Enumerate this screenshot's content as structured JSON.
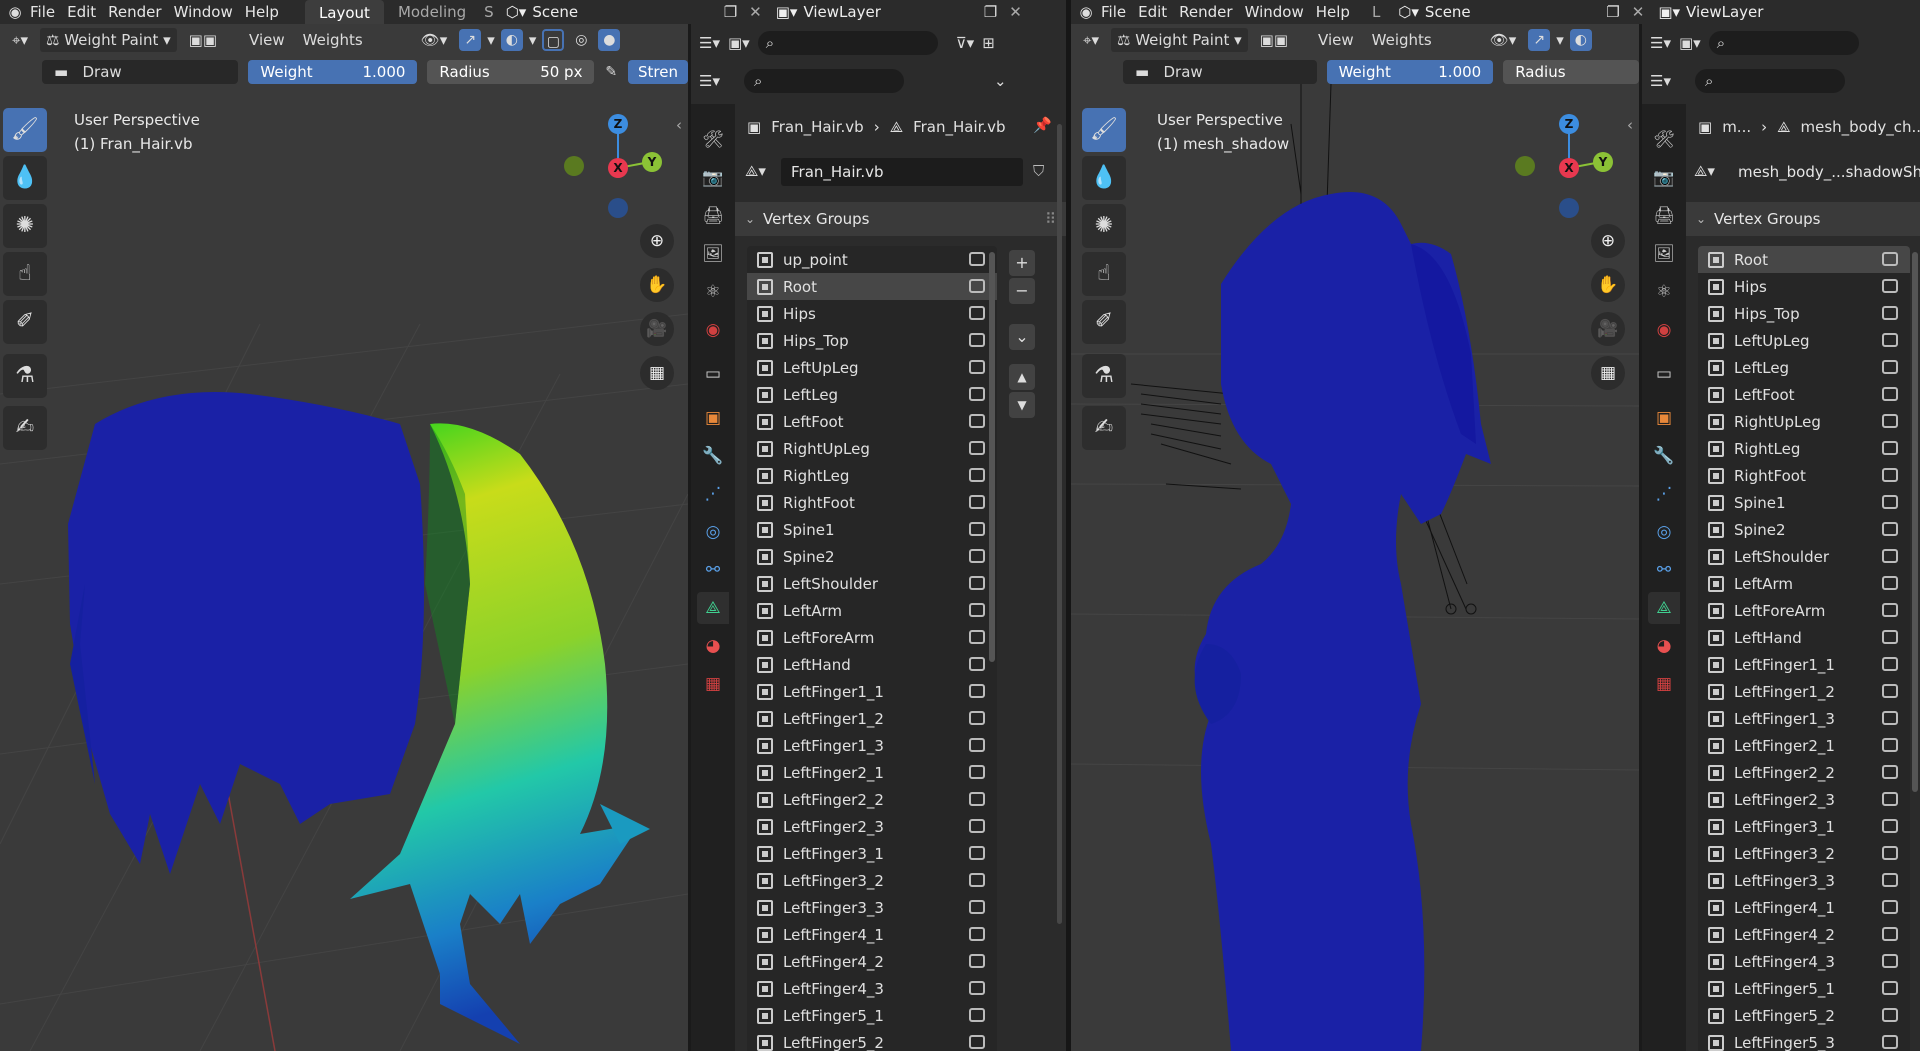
{
  "left": {
    "topbar": {
      "menus": [
        "File",
        "Edit",
        "Render",
        "Window",
        "Help"
      ],
      "workspace_tabs": [
        "Layout",
        "Modeling",
        "S"
      ],
      "active_tab": "Layout",
      "scene": "Scene",
      "viewlayer": "ViewLayer"
    },
    "viewport": {
      "mode": "Weight Paint",
      "view_menu": "View",
      "weights_menu": "Weights",
      "brush": "Draw",
      "weight_label": "Weight",
      "weight_value": "1.000",
      "radius_label": "Radius",
      "radius_value": "50 px",
      "strength_label": "Stren",
      "perspective": "User Perspective",
      "object": "(1) Fran_Hair.vb"
    },
    "properties": {
      "breadcrumb_object": "Fran_Hair.vb",
      "breadcrumb_data": "Fran_Hair.vb",
      "data_name": "Fran_Hair.vb",
      "panel_title": "Vertex Groups",
      "selected": "Root",
      "groups": [
        "up_point",
        "Root",
        "Hips",
        "Hips_Top",
        "LeftUpLeg",
        "LeftLeg",
        "LeftFoot",
        "RightUpLeg",
        "RightLeg",
        "RightFoot",
        "Spine1",
        "Spine2",
        "LeftShoulder",
        "LeftArm",
        "LeftForeArm",
        "LeftHand",
        "LeftFinger1_1",
        "LeftFinger1_2",
        "LeftFinger1_3",
        "LeftFinger2_1",
        "LeftFinger2_2",
        "LeftFinger2_3",
        "LeftFinger3_1",
        "LeftFinger3_2",
        "LeftFinger3_3",
        "LeftFinger4_1",
        "LeftFinger4_2",
        "LeftFinger4_3",
        "LeftFinger5_1",
        "LeftFinger5_2"
      ]
    }
  },
  "right": {
    "topbar": {
      "menus": [
        "File",
        "Edit",
        "Render",
        "Window",
        "Help"
      ],
      "workspace_tabs": [
        "L"
      ],
      "scene": "Scene",
      "viewlayer": "ViewLayer"
    },
    "viewport": {
      "mode": "Weight Paint",
      "view_menu": "View",
      "weights_menu": "Weights",
      "brush": "Draw",
      "weight_label": "Weight",
      "weight_value": "1.000",
      "radius_label": "Radius",
      "perspective": "User Perspective",
      "object": "(1) mesh_shadow"
    },
    "properties": {
      "breadcrumb_object": "m...",
      "breadcrumb_data": "mesh_body_ch...",
      "data_name": "mesh_body_...shadowSha",
      "panel_title": "Vertex Groups",
      "selected": "Root",
      "groups": [
        "Root",
        "Hips",
        "Hips_Top",
        "LeftUpLeg",
        "LeftLeg",
        "LeftFoot",
        "RightUpLeg",
        "RightLeg",
        "RightFoot",
        "Spine1",
        "Spine2",
        "LeftShoulder",
        "LeftArm",
        "LeftForeArm",
        "LeftHand",
        "LeftFinger1_1",
        "LeftFinger1_2",
        "LeftFinger1_3",
        "LeftFinger2_1",
        "LeftFinger2_2",
        "LeftFinger2_3",
        "LeftFinger3_1",
        "LeftFinger3_2",
        "LeftFinger3_3",
        "LeftFinger4_1",
        "LeftFinger4_2",
        "LeftFinger4_3",
        "LeftFinger5_1",
        "LeftFinger5_2",
        "LeftFinger5_3"
      ]
    }
  },
  "gizmo": {
    "z": "Z",
    "x": "X",
    "y": "Y"
  },
  "colors": {
    "accent": "#4772b3",
    "weight_zero": "#1020a8",
    "weight_mid": "#20c020",
    "weight_high": "#d8e020",
    "x_axis": "#e8384f",
    "y_axis": "#8bc236",
    "z_axis": "#3c8de0"
  },
  "icons": {
    "tools": [
      "draw-brush-icon",
      "blur-icon",
      "average-icon",
      "smear-icon",
      "sample-weight-icon",
      "sample-vertex-group-icon",
      "annotate-icon"
    ],
    "prop_tabs": [
      "tool-icon",
      "render-icon",
      "output-icon",
      "view-layer-icon",
      "scene-icon",
      "world-icon",
      "collection-icon",
      "object-icon",
      "modifier-icon",
      "particles-icon",
      "physics-icon",
      "constraints-icon",
      "object-data-icon",
      "material-icon",
      "texture-icon"
    ],
    "nav": [
      "zoom-icon",
      "pan-hand-icon",
      "camera-icon",
      "ortho-grid-icon"
    ]
  }
}
